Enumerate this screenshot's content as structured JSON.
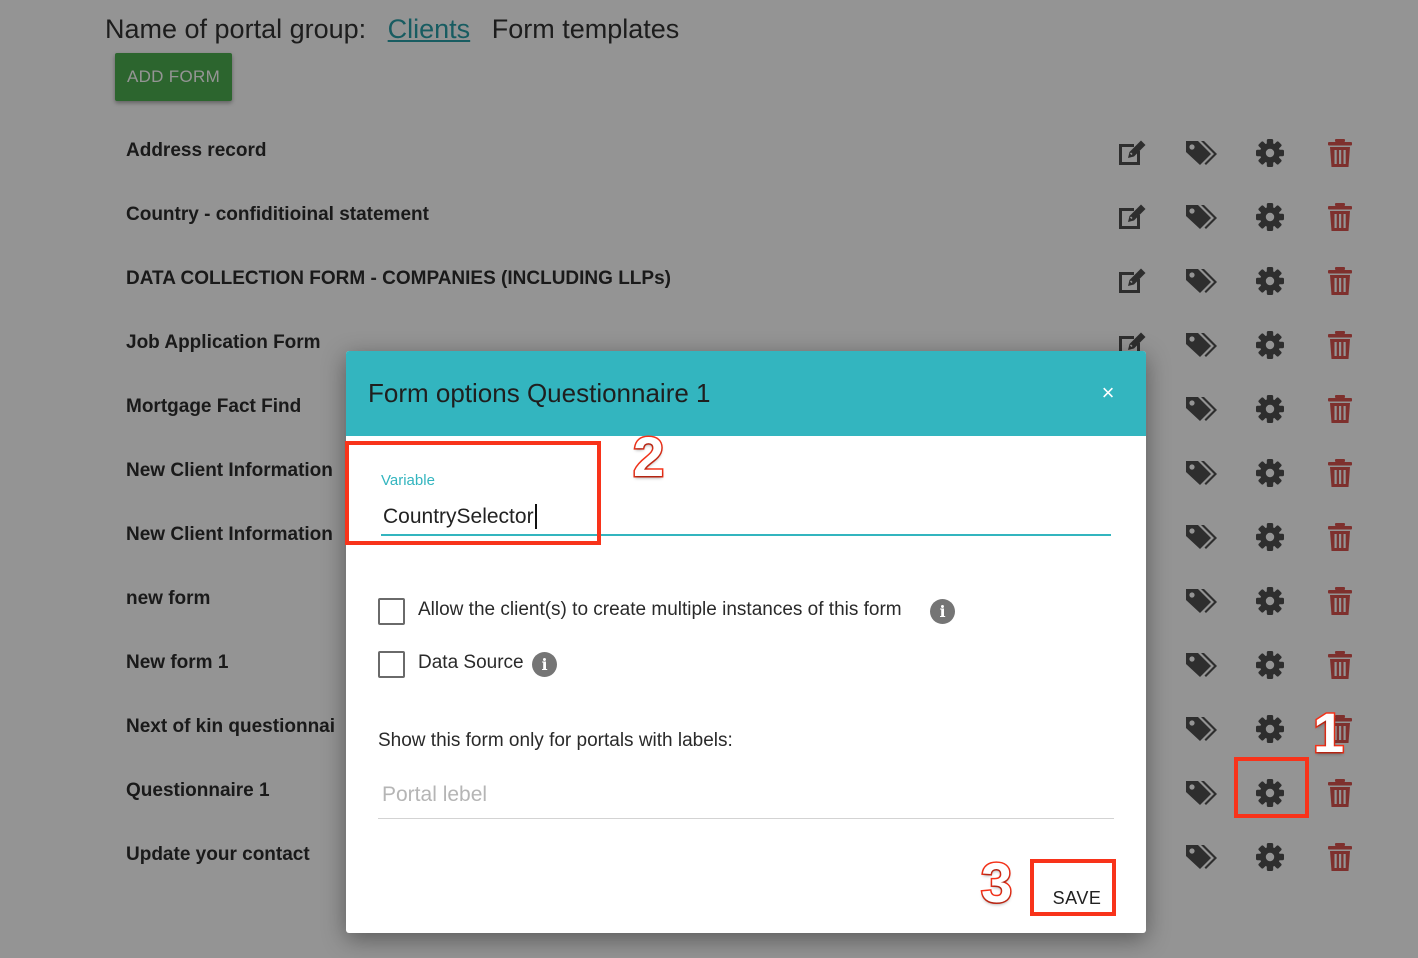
{
  "header": {
    "group_label": "Name of portal group:",
    "group_link": "Clients",
    "section": "Form templates"
  },
  "toolbar": {
    "add_form_label": "ADD FORM"
  },
  "forms": [
    {
      "name": "Address record"
    },
    {
      "name": "Country - confiditioinal statement"
    },
    {
      "name": "DATA COLLECTION FORM - COMPANIES (INCLUDING LLPs)"
    },
    {
      "name": "Job Application Form"
    },
    {
      "name": "Mortgage Fact Find"
    },
    {
      "name": "New Client Information"
    },
    {
      "name": "New Client Information"
    },
    {
      "name": "new form"
    },
    {
      "name": "New form 1"
    },
    {
      "name": "Next of kin questionnai"
    },
    {
      "name": "Questionnaire 1"
    },
    {
      "name": "Update your contact"
    }
  ],
  "row_icons": {
    "edit": "edit-icon",
    "tag": "tag-icon",
    "gear": "gear-icon",
    "trash": "trash-icon"
  },
  "modal": {
    "title": "Form options Questionnaire 1",
    "close_glyph": "×",
    "variable_label": "Variable",
    "variable_value": "CountrySelector",
    "multiple_instances_label": "Allow the client(s) to create multiple instances of this form",
    "multiple_instances_checked": false,
    "data_source_label": "Data Source",
    "data_source_checked": false,
    "info_glyph": "i",
    "labels_title": "Show this form only for portals with labels:",
    "portal_label_placeholder": "Portal lebel",
    "save_label": "SAVE"
  },
  "annotations": [
    "1",
    "2",
    "3"
  ],
  "colors": {
    "accent": "#33b5bf",
    "add_button": "#4caf50",
    "icon": "#505050",
    "trash": "#d9534f",
    "annotation": "#f8331a"
  }
}
